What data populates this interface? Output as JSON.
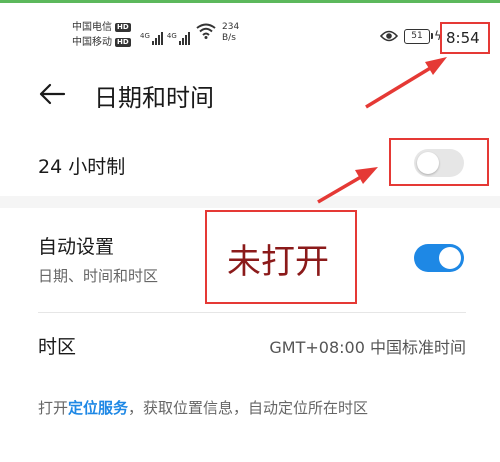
{
  "status_bar": {
    "carriers": [
      {
        "name": "中国电信",
        "badge": "HD"
      },
      {
        "name": "中国移动",
        "badge": "HD"
      }
    ],
    "signal_labels": [
      "4G",
      "4G"
    ],
    "net_speed_value": "234",
    "net_speed_unit": "B/s",
    "battery_level": "51",
    "time": "8:54",
    "icons": [
      "signal-icon",
      "wifi-icon",
      "eye-icon",
      "battery-icon",
      "charging-icon"
    ]
  },
  "header": {
    "title": "日期和时间",
    "back_icon": "arrow-left-icon"
  },
  "settings": {
    "hour24": {
      "label": "24 小时制",
      "enabled": false
    },
    "auto_set": {
      "label": "自动设置",
      "sublabel": "日期、时间和时区",
      "enabled": true
    },
    "timezone": {
      "label": "时区",
      "value": "GMT+08:00 中国标准时间"
    },
    "description": {
      "prefix": "打开",
      "link": "定位服务",
      "suffix": "，获取位置信息，自动定位所在时区"
    }
  },
  "annotation": {
    "callout_text": "未打开",
    "color": "#e53935",
    "text_color": "#8b1a1a"
  },
  "colors": {
    "accent": "#1e88e5",
    "toggle_off": "#e6e6e6",
    "top_line": "#5cb85c"
  }
}
